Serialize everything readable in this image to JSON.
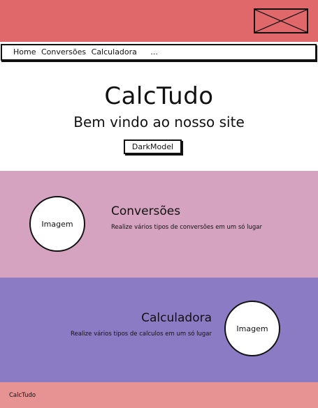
{
  "nav": {
    "items": [
      "Home",
      "Conversões",
      "Calculadora"
    ],
    "more": "..."
  },
  "hero": {
    "title": "CalcTudo",
    "subtitle": "Bem vindo ao nosso site",
    "dark_button": "DarkModel"
  },
  "sections": {
    "conversoes": {
      "image_label": "Imagem",
      "title": "Conversões",
      "description": "Realize vários tipos de conversões em um só lugar"
    },
    "calculadora": {
      "image_label": "Imagem",
      "title": "Calculadora",
      "description": "Realize vários tipos de calculos em um só lugar"
    }
  },
  "footer": {
    "text": "CalcTudo"
  },
  "colors": {
    "header": "#e0676a",
    "section_conversoes": "#d5a3c0",
    "section_calculadora": "#8b7ac4",
    "footer": "#e89393"
  },
  "icons": {
    "logo": "image-placeholder-icon"
  }
}
